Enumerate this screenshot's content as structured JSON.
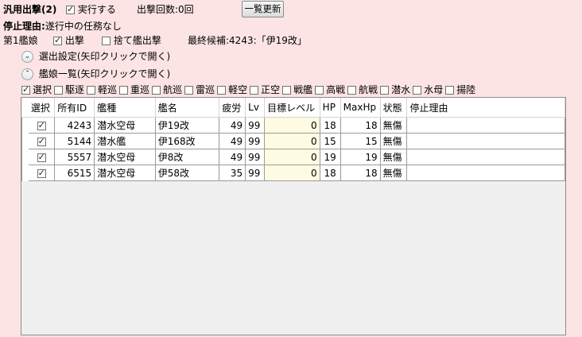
{
  "header": {
    "title": "汎用出撃(2)",
    "execute_label": "実行する",
    "execute_checked": true,
    "sortie_count_label": "出撃回数:0回",
    "refresh_button": "一覧更新"
  },
  "status": {
    "stop_reason_label": "停止理由:",
    "stop_reason_value": "遂行中の任務なし"
  },
  "fleet_line": {
    "ship_label": "第1艦娘",
    "sortie_label": "出撃",
    "sortie_checked": true,
    "sacrifice_label": "捨て艦出撃",
    "sacrifice_checked": false,
    "candidate_text": "最終候補:4243:「伊19改」"
  },
  "sections": {
    "selection_settings": "選出設定(矢印クリックで開く)",
    "ship_list": "艦娘一覧(矢印クリックで開く)"
  },
  "type_filters": [
    {
      "label": "選択",
      "checked": true
    },
    {
      "label": "駆逐",
      "checked": false
    },
    {
      "label": "軽巡",
      "checked": false
    },
    {
      "label": "重巡",
      "checked": false
    },
    {
      "label": "航巡",
      "checked": false
    },
    {
      "label": "雷巡",
      "checked": false
    },
    {
      "label": "軽空",
      "checked": false
    },
    {
      "label": "正空",
      "checked": false
    },
    {
      "label": "戦艦",
      "checked": false
    },
    {
      "label": "高戦",
      "checked": false
    },
    {
      "label": "航戦",
      "checked": false
    },
    {
      "label": "潜水",
      "checked": false
    },
    {
      "label": "水母",
      "checked": false
    },
    {
      "label": "揚陸",
      "checked": false
    }
  ],
  "table": {
    "columns": [
      "選択",
      "所有ID",
      "艦種",
      "艦名",
      "疲労",
      "Lv",
      "目標レベル",
      "HP",
      "MaxHp",
      "状態",
      "停止理由"
    ],
    "rows": [
      {
        "selected": true,
        "id": "4243",
        "type": "潜水空母",
        "name": "伊19改",
        "fatigue": "49",
        "lv": "99",
        "target": "0",
        "hp": "18",
        "maxhp": "18",
        "state": "無傷",
        "reason": ""
      },
      {
        "selected": true,
        "id": "5144",
        "type": "潜水艦",
        "name": "伊168改",
        "fatigue": "49",
        "lv": "99",
        "target": "0",
        "hp": "15",
        "maxhp": "15",
        "state": "無傷",
        "reason": ""
      },
      {
        "selected": true,
        "id": "5557",
        "type": "潜水空母",
        "name": "伊8改",
        "fatigue": "49",
        "lv": "99",
        "target": "0",
        "hp": "19",
        "maxhp": "19",
        "state": "無傷",
        "reason": ""
      },
      {
        "selected": true,
        "id": "6515",
        "type": "潜水空母",
        "name": "伊58改",
        "fatigue": "35",
        "lv": "99",
        "target": "0",
        "hp": "18",
        "maxhp": "18",
        "state": "無傷",
        "reason": ""
      }
    ]
  }
}
